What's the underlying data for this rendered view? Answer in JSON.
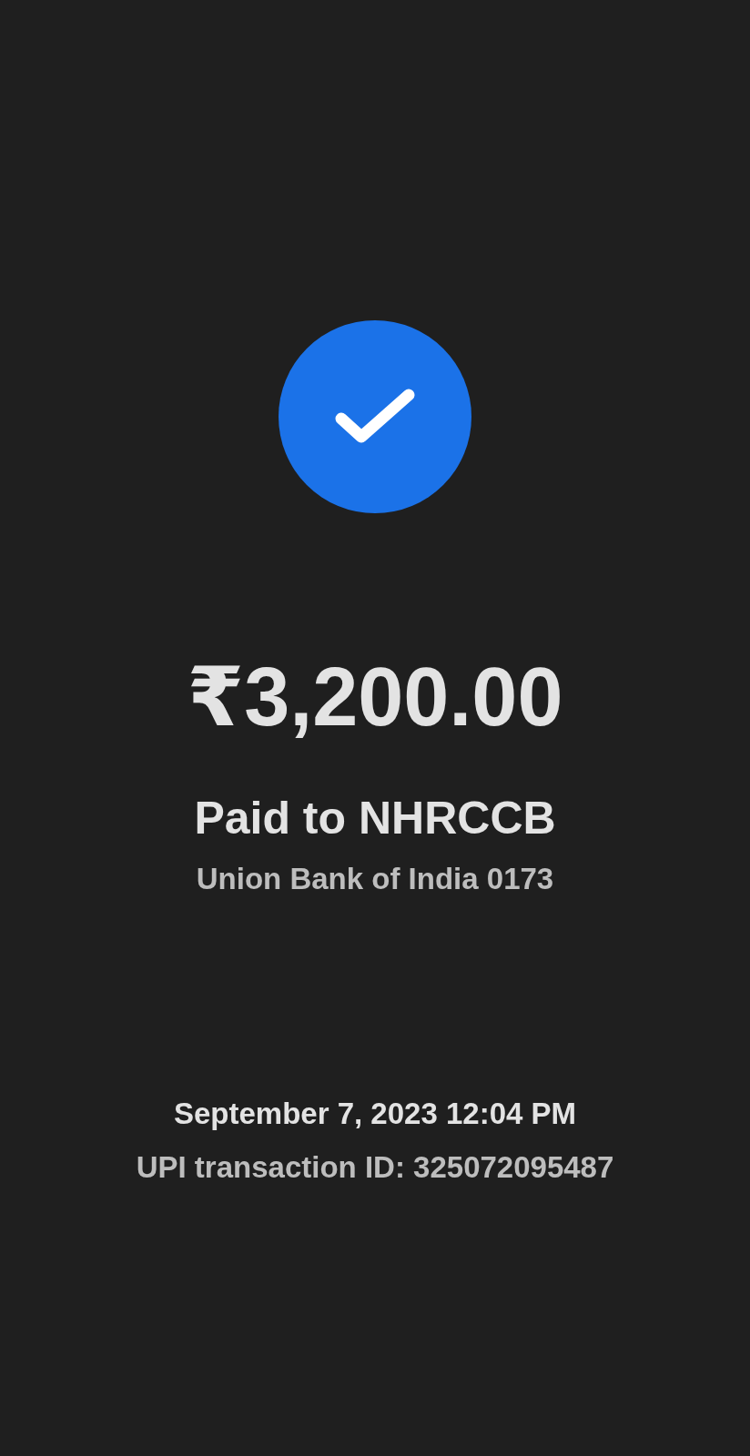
{
  "completed": true,
  "amount": "₹3,200.00",
  "payee": "Paid to NHRCCB",
  "account": "Union Bank of India 0173",
  "datetime": "September 7, 2023 12:04 PM",
  "transaction_id": "UPI transaction ID: 325072095487"
}
